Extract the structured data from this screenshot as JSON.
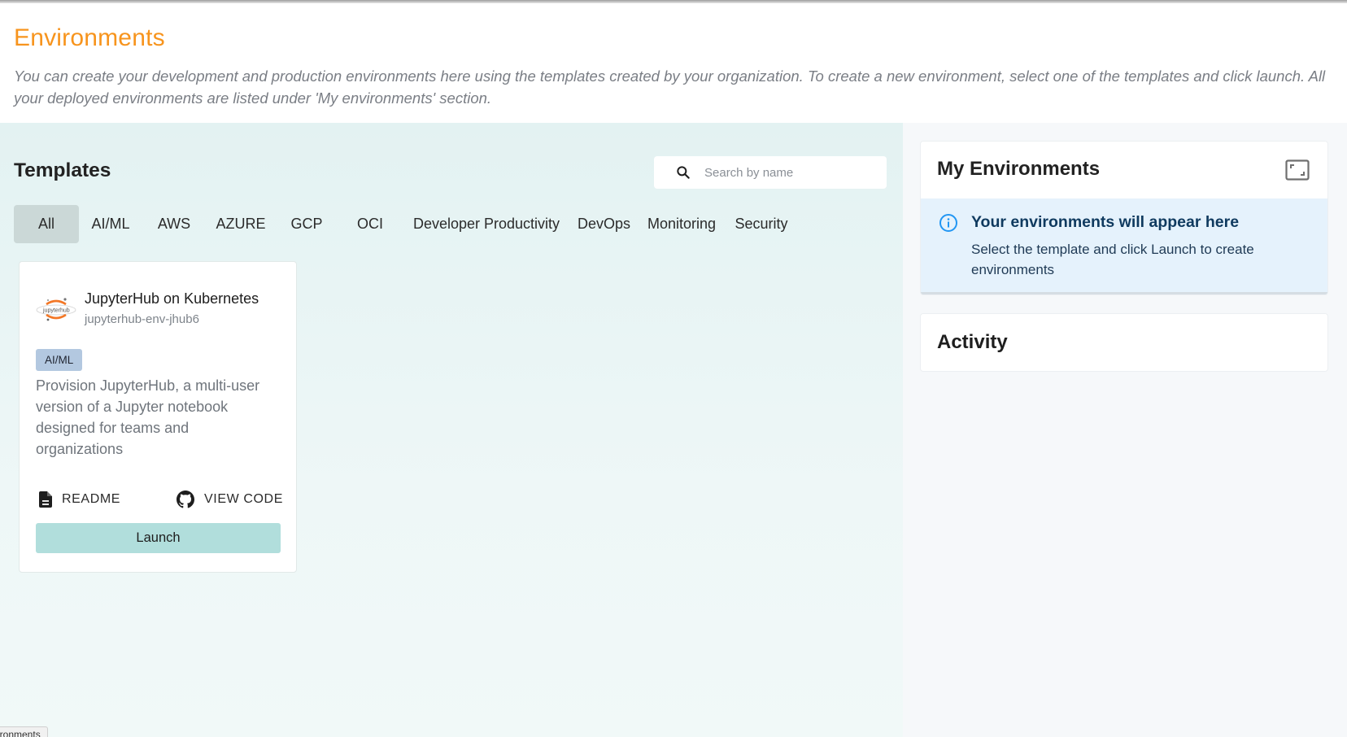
{
  "header": {
    "title": "Environments",
    "description": "You can create your development and production environments here using the templates created by your organization. To create a new environment, select one of the templates and click launch. All your deployed environments are listed under 'My environments' section."
  },
  "templates": {
    "title": "Templates",
    "search": {
      "placeholder": "Search by name",
      "value": "",
      "icon": "search-icon"
    },
    "tabs": [
      {
        "label": "All",
        "active": true
      },
      {
        "label": "AI/ML"
      },
      {
        "label": "AWS"
      },
      {
        "label": "AZURE"
      },
      {
        "label": "GCP"
      },
      {
        "label": "OCI"
      },
      {
        "label": "Developer Productivity"
      },
      {
        "label": "DevOps"
      },
      {
        "label": "Monitoring"
      },
      {
        "label": "Security"
      }
    ],
    "cards": [
      {
        "logo": "jupyterhub-logo",
        "logo_text": "jupyterhub",
        "title": "JupyterHub on Kubernetes",
        "subtitle": "jupyterhub-env-jhub6",
        "tag": "AI/ML",
        "description": "Provision JupyterHub, a multi-user version of a Jupyter notebook designed for teams and organizations",
        "readme_label": "README",
        "readme_icon": "file-icon",
        "view_code_label": "VIEW CODE",
        "view_code_icon": "github-icon",
        "launch_label": "Launch"
      }
    ]
  },
  "my_environments": {
    "title": "My Environments",
    "expand_icon": "expand-icon",
    "empty_title": "Your environments will appear here",
    "empty_text": "Select the template and click Launch to create environments",
    "info_icon": "info-icon"
  },
  "activity": {
    "title": "Activity"
  },
  "status_tooltip": "vironments",
  "colors": {
    "title_orange": "#f7941d",
    "active_tab": "#cbd8d7",
    "tag_bg": "#b3c8e0",
    "launch_bg": "#b1dedc",
    "info_bg": "#e5f2fc",
    "info_icon": "#2196f3"
  }
}
